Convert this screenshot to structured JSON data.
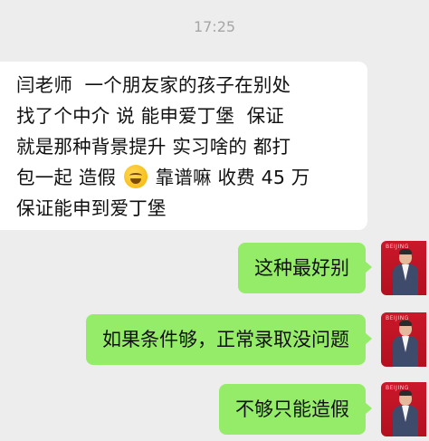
{
  "timestamp": "17:25",
  "incoming_message": {
    "lines": [
      "闫老师  一个朋友家的孩子在别处",
      "找了个中介 说 能申爱丁堡  保证",
      "就是那种背景提升 实习啥的 都打",
      [
        "包一起 造假 ",
        " 靠谱嘛 收费 45 万"
      ],
      "保证能申到爱丁堡"
    ],
    "emoji": "laughing-with-tears-emoji"
  },
  "outgoing_messages": [
    {
      "text": "这种最好别"
    },
    {
      "text": "如果条件够，正常录取没问题"
    },
    {
      "text": "不够只能造假"
    }
  ],
  "avatar": {
    "brand_text": "BEIJING"
  },
  "colors": {
    "background": "#ededed",
    "incoming_bubble": "#ffffff",
    "outgoing_bubble": "#95ec69",
    "avatar_bg": "#c9182a"
  }
}
